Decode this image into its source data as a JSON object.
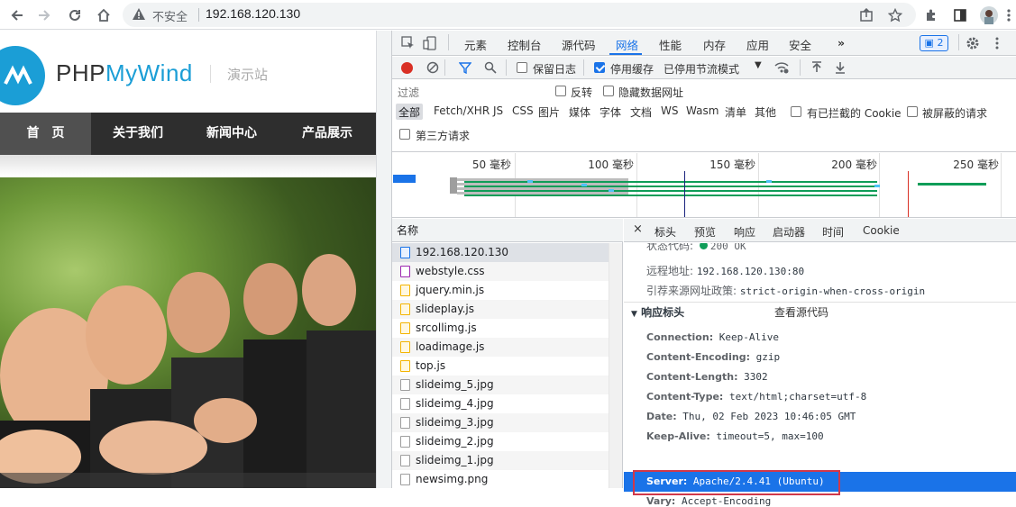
{
  "browser": {
    "security_label": "不安全",
    "url": "192.168.120.130"
  },
  "site": {
    "logo_php": "PHP",
    "logo_wind": "MyWind",
    "demo_label": "演示站",
    "nav": [
      "首　页",
      "关于我们",
      "新闻中心",
      "产品展示"
    ]
  },
  "devtools": {
    "tabs": [
      "元素",
      "控制台",
      "源代码",
      "网络",
      "性能",
      "内存",
      "应用",
      "安全"
    ],
    "active_tab": "网络",
    "issues_count": "2",
    "toolbar": {
      "preserve_log": "保留日志",
      "disable_cache": "停用缓存",
      "throttling": "已停用节流模式"
    },
    "filter": {
      "placeholder": "过滤",
      "invert": "反转",
      "hide_data_urls": "隐藏数据网址",
      "types": [
        "全部",
        "Fetch/XHR",
        "JS",
        "CSS",
        "图片",
        "媒体",
        "字体",
        "文档",
        "WS",
        "Wasm",
        "清单",
        "其他"
      ],
      "blocked_cookies": "有已拦截的 Cookie",
      "blocked_requests": "被屏蔽的请求",
      "third_party": "第三方请求"
    },
    "overview_ticks": [
      "50 毫秒",
      "100 毫秒",
      "150 毫秒",
      "200 毫秒",
      "250 毫秒"
    ],
    "name_header": "名称",
    "requests": [
      {
        "name": "192.168.120.130",
        "icon": "document-icon"
      },
      {
        "name": "webstyle.css",
        "icon": "stylesheet-icon"
      },
      {
        "name": "jquery.min.js",
        "icon": "script-icon"
      },
      {
        "name": "slideplay.js",
        "icon": "script-icon"
      },
      {
        "name": "srcollimg.js",
        "icon": "script-icon"
      },
      {
        "name": "loadimage.js",
        "icon": "script-icon"
      },
      {
        "name": "top.js",
        "icon": "script-icon"
      },
      {
        "name": "slideimg_5.jpg",
        "icon": "image-icon"
      },
      {
        "name": "slideimg_4.jpg",
        "icon": "image-icon"
      },
      {
        "name": "slideimg_3.jpg",
        "icon": "image-icon"
      },
      {
        "name": "slideimg_2.jpg",
        "icon": "image-icon"
      },
      {
        "name": "slideimg_1.jpg",
        "icon": "image-icon"
      },
      {
        "name": "newsimg.png",
        "icon": "image-icon"
      }
    ],
    "detail_tabs": [
      "标头",
      "预览",
      "响应",
      "启动器",
      "时间",
      "Cookie"
    ],
    "general": {
      "status_label": "状态代码:",
      "status_value": "200 OK",
      "remote_label": "远程地址:",
      "remote_value": "192.168.120.130:80",
      "referrer_label": "引荐来源网址政策:",
      "referrer_value": "strict-origin-when-cross-origin"
    },
    "response_headers_title": "响应标头",
    "view_source": "查看源代码",
    "headers": [
      {
        "key": "Connection:",
        "value": "Keep-Alive"
      },
      {
        "key": "Content-Encoding:",
        "value": "gzip"
      },
      {
        "key": "Content-Length:",
        "value": "3302"
      },
      {
        "key": "Content-Type:",
        "value": "text/html;charset=utf-8"
      },
      {
        "key": "Date:",
        "value": "Thu, 02 Feb 2023 10:46:05 GMT"
      },
      {
        "key": "Keep-Alive:",
        "value": "timeout=5, max=100"
      },
      {
        "key": "Server:",
        "value": "Apache/2.4.41 (Ubuntu)"
      },
      {
        "key": "Vary:",
        "value": "Accept-Encoding"
      }
    ]
  },
  "colors": {
    "accent": "#1a73e8",
    "highlight_box": "#d0384a",
    "brand": "#1b9ed6"
  }
}
